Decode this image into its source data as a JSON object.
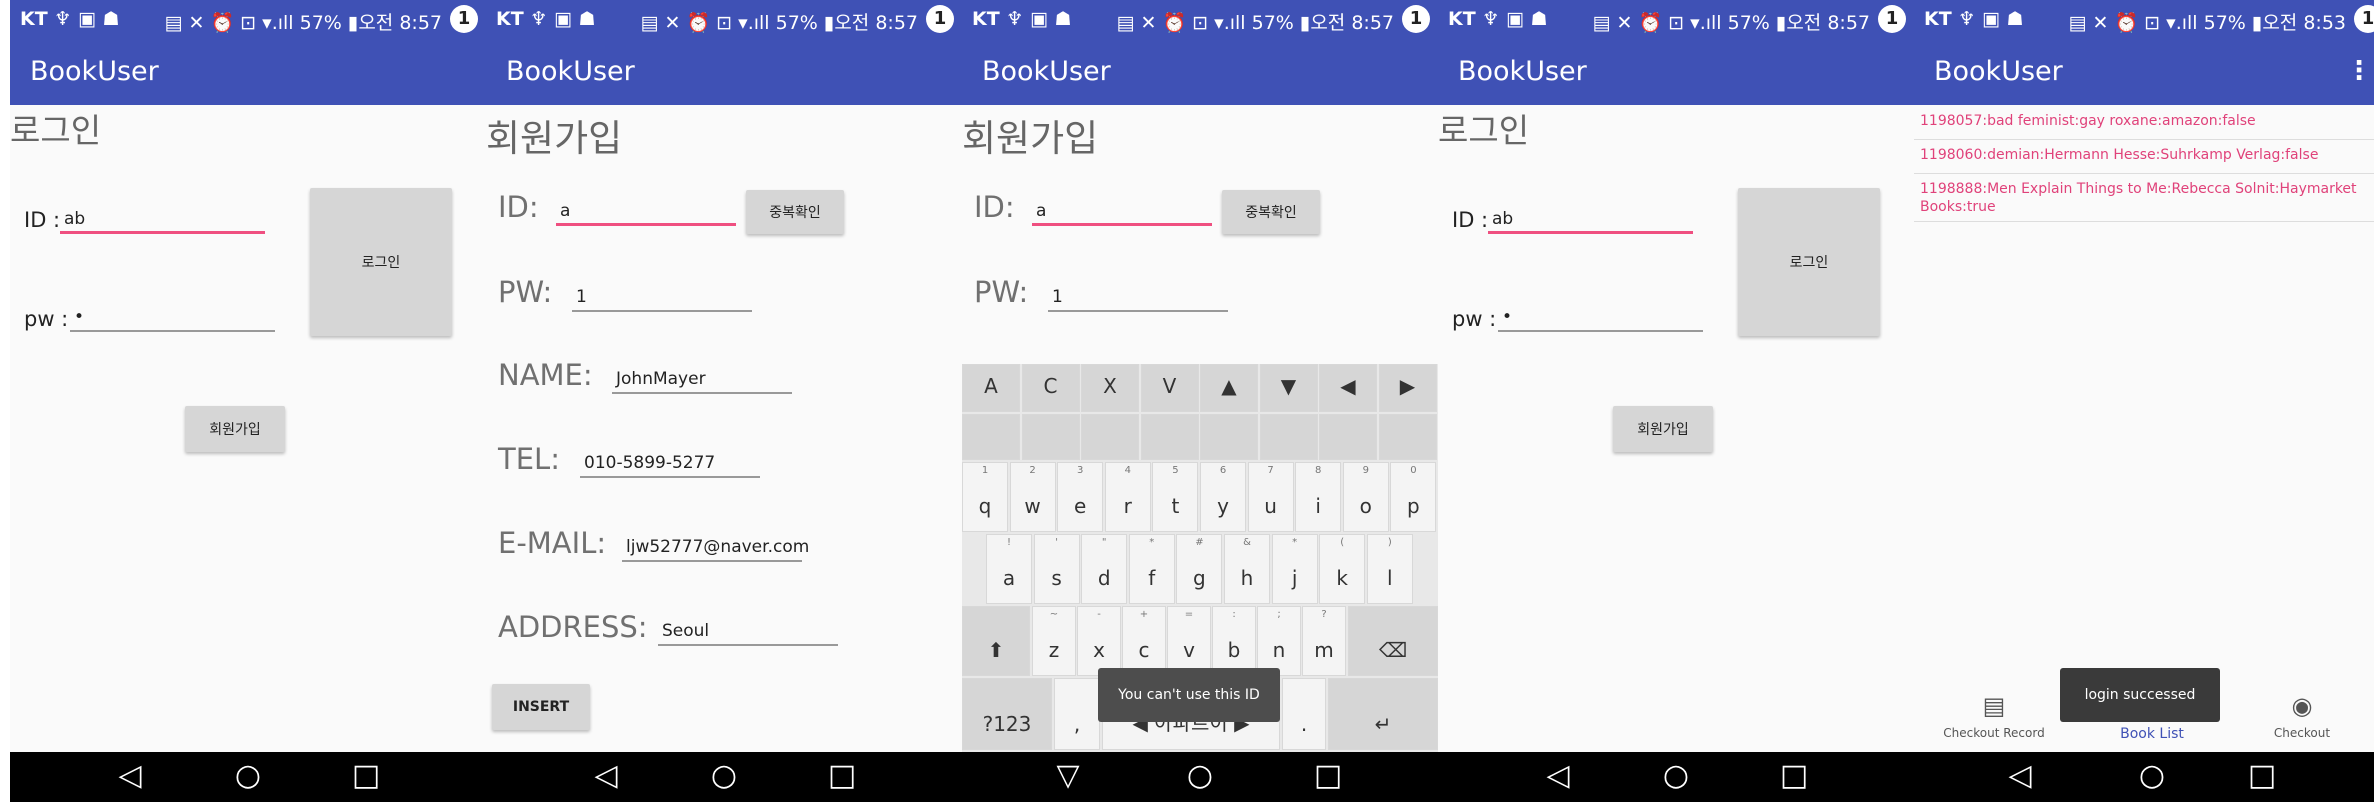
{
  "status": {
    "left": "KT ♆ ▣ ☗",
    "right": "▤ ✕ ⏰ ⊡ ▾.ıll 57% ▮오전 8:57",
    "right_last": "▤ ✕ ⏰ ⊡ ▾.ıll 57% ▮오전 8:53",
    "notif": "1"
  },
  "app_title": "BookUser",
  "login": {
    "heading": "로그인",
    "id_label": "ID :",
    "id_value": "ab",
    "pw_label": "pw :",
    "pw_value": "•",
    "login_button": "로그인",
    "signup_button": "회원가입"
  },
  "signup": {
    "heading": "회원가입",
    "id_label": "ID:",
    "id_value": "a",
    "check_button": "중복확인",
    "pw_label": "PW:",
    "pw_value": "1",
    "name_label": "NAME:",
    "name_value": "JohnMayer",
    "tel_label": "TEL:",
    "tel_value": "010-5899-5277",
    "email_label": "E-MAIL:",
    "email_value": "ljw52777@naver.com",
    "address_label": "ADDRESS:",
    "address_value": "Seoul",
    "insert_button": "INSERT"
  },
  "keyboard": {
    "row0": [
      "A",
      "C",
      "X",
      "V",
      "▲",
      "▼",
      "◀",
      "▶"
    ],
    "row2": [
      "q",
      "w",
      "e",
      "r",
      "t",
      "y",
      "u",
      "i",
      "o",
      "p"
    ],
    "row2_hints": [
      "1",
      "2",
      "3",
      "4",
      "5",
      "6",
      "7",
      "8",
      "9",
      "0"
    ],
    "row3": [
      "a",
      "s",
      "d",
      "f",
      "g",
      "h",
      "j",
      "k",
      "l"
    ],
    "row3_hints": [
      "!",
      "'",
      "\"",
      "*",
      "#",
      "&",
      "*",
      "(",
      ")"
    ],
    "row4": [
      "z",
      "x",
      "c",
      "v",
      "b",
      "n",
      "m"
    ],
    "row4_hints": [
      "~",
      "-",
      "+",
      "=",
      ":",
      ";",
      "?"
    ],
    "shift": "⬆",
    "backspace": "⌫",
    "symbols": "?123",
    "comma": ",",
    "space_label": "◀ 아파트이 ▶",
    "period": ".",
    "enter": "↵",
    "toast": "You can't use this ID"
  },
  "book_list": {
    "items": [
      "1198057:bad feminist:gay roxane:amazon:false",
      "1198060:demian:Hermann Hesse:Suhrkamp Verlag:false",
      "1198888:Men Explain Things to Me:Rebecca Solnit:Haymarket Books:true"
    ],
    "tabs": [
      {
        "label": "Checkout Record",
        "icon": "▤"
      },
      {
        "label": "Book List",
        "icon": "▬"
      },
      {
        "label": "Checkout",
        "icon": "◉"
      }
    ],
    "toast": "login successed",
    "menu": "⋮"
  },
  "nav": {
    "back": "◁",
    "home": "○",
    "recent": "□",
    "back_down": "▽"
  }
}
